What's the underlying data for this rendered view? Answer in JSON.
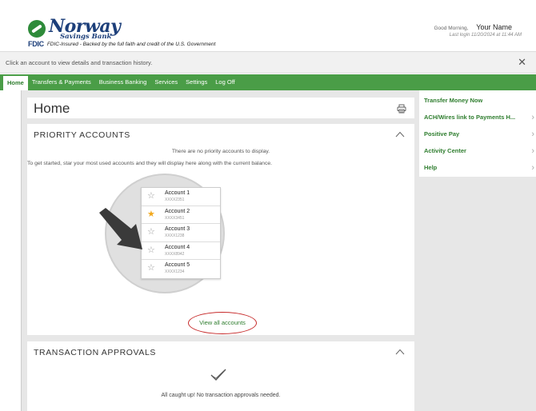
{
  "header": {
    "bank_name": "Norway",
    "bank_sub": "Savings Bank",
    "fdic_tag": "FDIC",
    "fdic_text": "FDIC-Insured - Backed by the full faith and credit of the U.S. Government",
    "greeting": "Good Morning,",
    "user_name": "Your Name",
    "last_login": "Last login 11/20/2024 at 11:44 AM"
  },
  "infobar": {
    "message": "Click an account to view details and transaction history.",
    "close_glyph": "✕"
  },
  "nav": {
    "items": [
      "Home",
      "Transfers & Payments",
      "Business Banking",
      "Services",
      "Settings",
      "Log Off"
    ],
    "active": "Home"
  },
  "home": {
    "title": "Home"
  },
  "priority": {
    "title": "PRIORITY ACCOUNTS",
    "empty_message": "There are no priority accounts to display.",
    "instructions": "To get started, star your most used accounts and they will display here along with the current balance.",
    "accounts": [
      {
        "name": "Account 1",
        "number": "XXXX2351",
        "starred": false
      },
      {
        "name": "Account 2",
        "number": "XXXX3451",
        "starred": true
      },
      {
        "name": "Account 3",
        "number": "XXXX1238",
        "starred": false
      },
      {
        "name": "Account 4",
        "number": "XXXX8942",
        "starred": false
      },
      {
        "name": "Account 5",
        "number": "XXXX1234",
        "starred": false
      }
    ],
    "view_all": "View all accounts"
  },
  "approvals": {
    "title": "TRANSACTION APPROVALS",
    "message": "All caught up! No transaction approvals needed."
  },
  "sidebar": {
    "items": [
      {
        "label": "Transfer Money Now",
        "chevron": false
      },
      {
        "label": "ACH/Wires link to Payments H...",
        "chevron": true
      },
      {
        "label": "Positive Pay",
        "chevron": true
      },
      {
        "label": "Activity Center",
        "chevron": true
      },
      {
        "label": "Help",
        "chevron": true
      }
    ]
  },
  "icons": {
    "print": "printer-icon",
    "collapse": "chevron-up-icon",
    "check": "checkmark-icon",
    "star_empty": "☆",
    "star_filled": "★",
    "chevron_right": "›"
  },
  "colors": {
    "brand_green": "#4a9d47",
    "link_green": "#2e7d2e",
    "brand_blue": "#1d3f7a",
    "star_gold": "#f2a81d",
    "highlight_red": "#c62828"
  }
}
